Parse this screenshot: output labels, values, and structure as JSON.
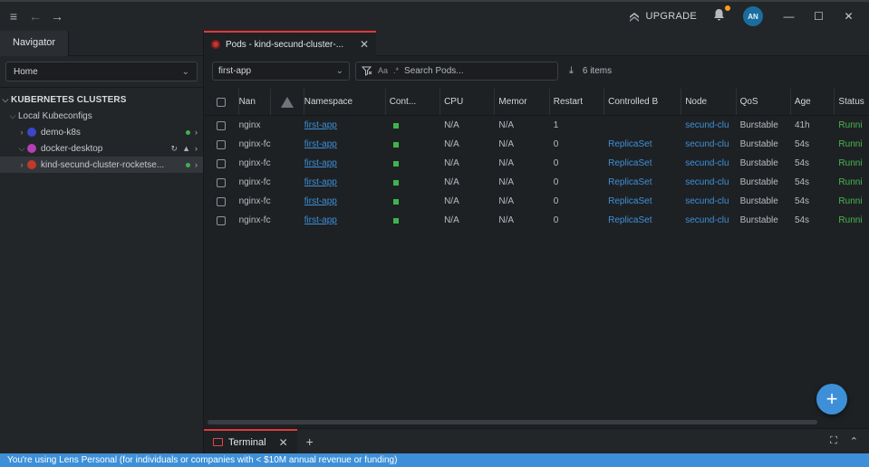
{
  "titlebar": {
    "upgrade_label": "UPGRADE",
    "avatar_initials": "AN",
    "notification_badge_color": "#ff9a1f"
  },
  "sidebar": {
    "tab_label": "Navigator",
    "context_value": "Home",
    "section_title": "KUBERNETES CLUSTERS",
    "group_label": "Local Kubeconfigs",
    "clusters": [
      {
        "name": "demo-k8s",
        "icon_color": "#3b47c8",
        "status": "connected"
      },
      {
        "name": "docker-desktop",
        "icon_color": "#b43fb4",
        "status": "warning"
      },
      {
        "name": "kind-secund-cluster-rocketse...",
        "icon_color": "#c0392b",
        "status": "connected"
      }
    ]
  },
  "main": {
    "tab_label": "Pods - kind-secund-cluster-...",
    "namespace_value": "first-app",
    "search_case_label": "Aa",
    "search_regex_label": ".*",
    "search_placeholder": "Search Pods...",
    "items_count": "6 items",
    "columns": [
      "Nan",
      "",
      "Namespace",
      "Cont...",
      "CPU",
      "Memor",
      "Restart",
      "Controlled B",
      "Node",
      "QoS",
      "Age",
      "Status"
    ],
    "rows": [
      {
        "name": "nginx",
        "namespace": "first-app",
        "cpu": "N/A",
        "memory": "N/A",
        "restarts": "1",
        "controlled_by": "",
        "node": "secund-clu",
        "qos": "Burstable",
        "age": "41h",
        "status": "Runni"
      },
      {
        "name": "nginx-fc",
        "namespace": "first-app",
        "cpu": "N/A",
        "memory": "N/A",
        "restarts": "0",
        "controlled_by": "ReplicaSet",
        "node": "secund-clu",
        "qos": "Burstable",
        "age": "54s",
        "status": "Runni"
      },
      {
        "name": "nginx-fc",
        "namespace": "first-app",
        "cpu": "N/A",
        "memory": "N/A",
        "restarts": "0",
        "controlled_by": "ReplicaSet",
        "node": "secund-clu",
        "qos": "Burstable",
        "age": "54s",
        "status": "Runni"
      },
      {
        "name": "nginx-fc",
        "namespace": "first-app",
        "cpu": "N/A",
        "memory": "N/A",
        "restarts": "0",
        "controlled_by": "ReplicaSet",
        "node": "secund-clu",
        "qos": "Burstable",
        "age": "54s",
        "status": "Runni"
      },
      {
        "name": "nginx-fc",
        "namespace": "first-app",
        "cpu": "N/A",
        "memory": "N/A",
        "restarts": "0",
        "controlled_by": "ReplicaSet",
        "node": "secund-clu",
        "qos": "Burstable",
        "age": "54s",
        "status": "Runni"
      },
      {
        "name": "nginx-fc",
        "namespace": "first-app",
        "cpu": "N/A",
        "memory": "N/A",
        "restarts": "0",
        "controlled_by": "ReplicaSet",
        "node": "secund-clu",
        "qos": "Burstable",
        "age": "54s",
        "status": "Runni"
      }
    ]
  },
  "dock": {
    "terminal_label": "Terminal"
  },
  "statusbar": {
    "text": "You're using Lens Personal (for individuals or companies with < $10M annual revenue or funding)"
  },
  "colors": {
    "accent": "#3d90d8",
    "running": "#47b84f",
    "active_tab": "#e03a3a"
  }
}
